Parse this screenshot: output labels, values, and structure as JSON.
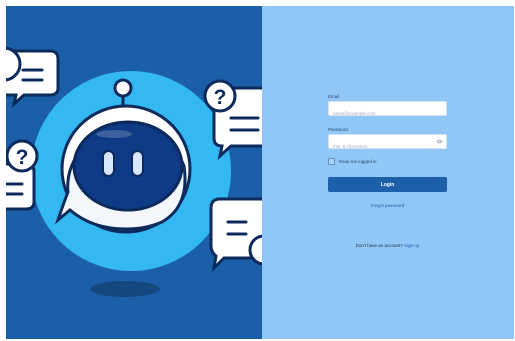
{
  "login": {
    "email_label": "Email",
    "email_placeholder": "name@example.com",
    "password_label": "Password",
    "password_placeholder": "min. 8 characters",
    "remember_label": "Keep me logged in",
    "login_button": "Login",
    "forgot_link": "Forgot password",
    "signup_prompt": "Don't have an account?",
    "signup_link": "Sign up"
  },
  "illustration": {
    "bubble_glyph": "?",
    "icons": [
      "robot-chatbot-illustration",
      "speech-bubble-icon",
      "question-bubble-icon",
      "eye-icon"
    ]
  },
  "colors": {
    "left_panel": "#1b5fa9",
    "right_panel": "#91c7f6",
    "button": "#1c60aa",
    "halo": "#34b8f2",
    "link": "#1e5da3"
  }
}
